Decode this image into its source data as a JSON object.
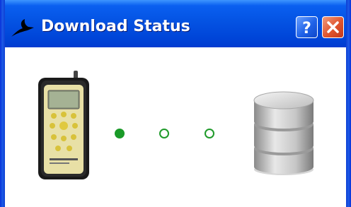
{
  "window": {
    "title": "Download Status",
    "title_icon": "swallow-bird-icon",
    "buttons": {
      "help": {
        "icon": "help-question-icon",
        "glyph": "?"
      },
      "close": {
        "icon": "close-x-icon"
      }
    }
  },
  "content": {
    "source_icon": "handheld-meter-device-icon",
    "target_icon": "database-stack-icon",
    "progress": {
      "total_steps": 3,
      "completed_steps": 1
    },
    "colors": {
      "progress_dot": "#1a9a28",
      "titlebar": "#0453e3"
    }
  }
}
